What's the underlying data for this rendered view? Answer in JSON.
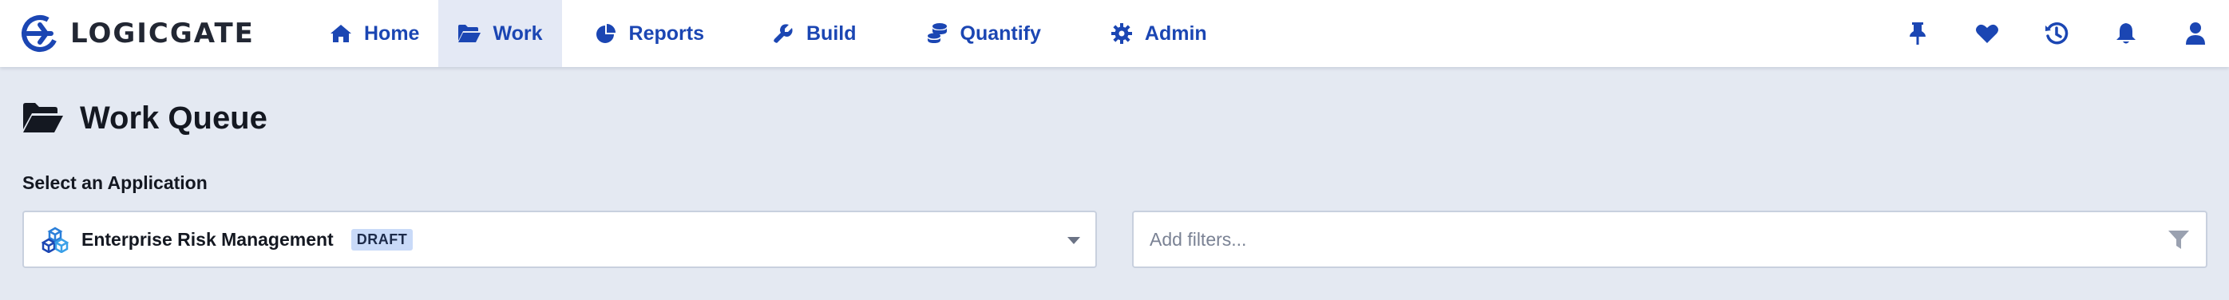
{
  "app": {
    "logo_text": "LOGICGATE"
  },
  "nav": {
    "items": [
      {
        "label": "Home",
        "icon": "home-icon"
      },
      {
        "label": "Work",
        "icon": "folder-open-icon",
        "active": true
      },
      {
        "label": "Reports",
        "icon": "pie-chart-icon"
      },
      {
        "label": "Build",
        "icon": "wrench-icon"
      },
      {
        "label": "Quantify",
        "icon": "coins-icon"
      },
      {
        "label": "Admin",
        "icon": "gear-icon"
      }
    ],
    "right_icons": [
      "pin-icon",
      "heart-icon",
      "history-icon",
      "bell-icon",
      "user-icon"
    ]
  },
  "page": {
    "title": "Work Queue",
    "title_icon": "folder-open-icon"
  },
  "application_select": {
    "label": "Select an Application",
    "value": "Enterprise Risk Management",
    "badge": "DRAFT",
    "icon": "cubes-icon"
  },
  "filters": {
    "placeholder": "Add filters...",
    "value": "",
    "icon": "filter-icon"
  },
  "colors": {
    "brand_blue": "#1b46b3",
    "background": "#e4e9f2",
    "active_tab": "#e4e9f5",
    "badge_bg": "#c9daf8"
  }
}
